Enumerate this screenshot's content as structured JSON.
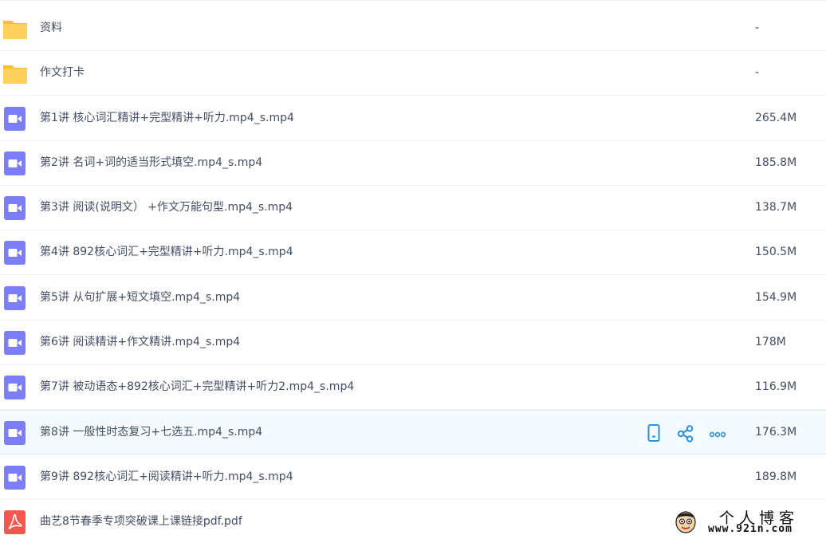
{
  "colors": {
    "folder": "#ffd15c",
    "folder_tab": "#f7bd3a",
    "video": "#7b7ef6",
    "pdf": "#f5574e",
    "action": "#2c90db",
    "hover_row": "#f4fbff"
  },
  "files": [
    {
      "name": "资料",
      "size": "-",
      "icon": "folder-icon"
    },
    {
      "name": "作文打卡",
      "size": "-",
      "icon": "folder-icon"
    },
    {
      "name": "第1讲 核心词汇精讲+完型精讲+听力.mp4_s.mp4",
      "size": "265.4M",
      "icon": "video-icon"
    },
    {
      "name": "第2讲 名词+词的适当形式填空.mp4_s.mp4",
      "size": "185.8M",
      "icon": "video-icon"
    },
    {
      "name": "第3讲 阅读(说明文） +作文万能句型.mp4_s.mp4",
      "size": "138.7M",
      "icon": "video-icon"
    },
    {
      "name": "第4讲 892核心词汇+完型精讲+听力.mp4_s.mp4",
      "size": "150.5M",
      "icon": "video-icon"
    },
    {
      "name": "第5讲 从句扩展+短文填空.mp4_s.mp4",
      "size": "154.9M",
      "icon": "video-icon"
    },
    {
      "name": "第6讲 阅读精讲+作文精讲.mp4_s.mp4",
      "size": "178M",
      "icon": "video-icon"
    },
    {
      "name": "第7讲 被动语态+892核心词汇+完型精讲+听力2.mp4_s.mp4",
      "size": "116.9M",
      "icon": "video-icon"
    },
    {
      "name": "第8讲 一般性时态复习+七选五.mp4_s.mp4",
      "size": "176.3M",
      "icon": "video-icon"
    },
    {
      "name": "第9讲 892核心词汇+阅读精讲+听力.mp4_s.mp4",
      "size": "189.8M",
      "icon": "video-icon"
    },
    {
      "name": "曲艺8节春季专项突破课上课链接pdf.pdf",
      "size": "",
      "icon": "pdf-icon"
    }
  ],
  "hover_actions": [
    "phone-icon",
    "share-icon",
    "more-icon"
  ],
  "watermark": {
    "title": "个人博客",
    "url": "www.92in.com"
  }
}
